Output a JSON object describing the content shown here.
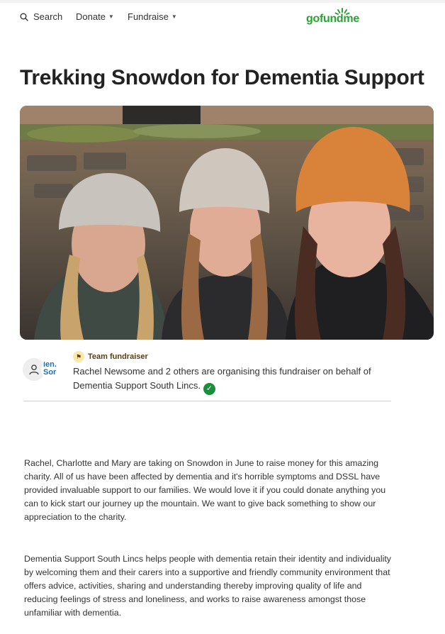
{
  "nav": {
    "search_label": "Search",
    "donate_label": "Donate",
    "fundraise_label": "Fundraise",
    "logo_text": "gofundme",
    "brand_color": "#29a333"
  },
  "campaign": {
    "title": "Trekking Snowdon for Dementia Support",
    "hero_image_icon": "photo-three-women-in-knit-hats"
  },
  "organiser": {
    "badge_label": "Team fundraiser",
    "avatar_logo_text": "len. Sor",
    "text": "Rachel Newsome and 2 others are organising this fundraiser on behalf of Dementia Support South Lincs.",
    "verified_icon": "check-circle-icon"
  },
  "story": {
    "paragraph1": "Rachel, Charlotte and Mary are taking on Snowdon in June to raise money for this amazing charity. All of us have been affected by dementia and it's horrible symptoms and DSSL have provided invaluable support to our families. We would love it if you could donate anything you can to kick start our journey up the mountain. We want to give back something to show our appreciation to the charity.",
    "paragraph2": "Dementia Support South Lincs helps people with dementia retain their identity and individuality by welcoming them and their carers into a supportive and friendly community environment that offers advice, activities, sharing and understanding thereby improving quality of life and reducing feelings of stress and loneliness, and works to raise awareness amongst those unfamiliar with dementia."
  }
}
